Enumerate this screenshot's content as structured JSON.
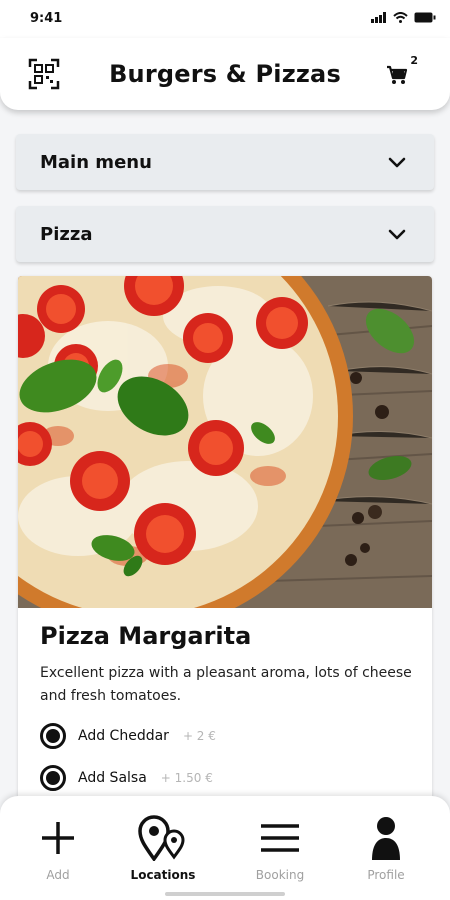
{
  "status": {
    "time": "9:41"
  },
  "header": {
    "title": "Burgers & Pizzas",
    "cart_count": "2"
  },
  "dropdowns": {
    "main": "Main menu",
    "category": "Pizza"
  },
  "product": {
    "name": "Pizza Margarita",
    "description": "Excellent pizza with a pleasant aroma, lots of cheese and fresh tomatoes.",
    "options": [
      {
        "label": "Add Cheddar",
        "price": "+ 2 €"
      },
      {
        "label": "Add Salsa",
        "price": "+ 1.50 €"
      }
    ]
  },
  "tabs": [
    {
      "label": "Add",
      "icon": "plus-icon"
    },
    {
      "label": "Locations",
      "icon": "map-pin-icon"
    },
    {
      "label": "Booking",
      "icon": "menu-icon"
    },
    {
      "label": "Profile",
      "icon": "person-icon"
    }
  ],
  "colors": {
    "accent": "#111111",
    "inactive": "#a0a0a0",
    "dropdown_bg": "#e9ecef"
  }
}
